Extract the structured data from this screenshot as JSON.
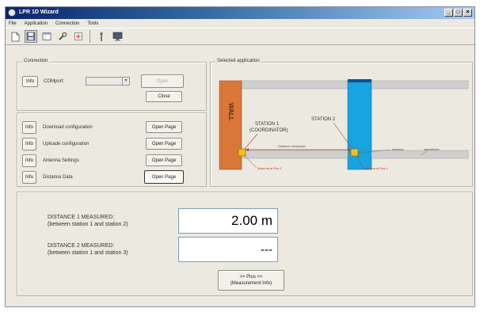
{
  "window": {
    "title": "LPR 1D Wizard"
  },
  "menu": [
    "File",
    "Application",
    "Connection",
    "Tools"
  ],
  "toolbar_icons": [
    "new-doc-icon",
    "disk-icon",
    "window-icon",
    "wrench-icon",
    "config-icon",
    "antenna-icon",
    "monitor-icon"
  ],
  "connection": {
    "title": "Connection",
    "info": "Info",
    "comport_label": "COMport:",
    "comport_value": "",
    "open_label": "Open",
    "close_label": "Close"
  },
  "pages": {
    "info": "Info",
    "rows": [
      {
        "label": "Download configuration",
        "button": "Open Page"
      },
      {
        "label": "Uploade configuration",
        "button": "Open Page"
      },
      {
        "label": "Antenna Settings",
        "button": "Open Page"
      },
      {
        "label": "Distance Data",
        "button": "Open Page"
      }
    ]
  },
  "application": {
    "title": "Selected application",
    "wall_label": "WALL",
    "station1_line1": "STATION 1",
    "station1_line2": "(COORDINATOR)",
    "station2_label": "STATION 2",
    "distance_label": "Distance measured",
    "antenna_label": "antenna",
    "stand_label": "stand/track",
    "ant1_label": "Antenna at Pos 1",
    "ant2_label": "Antenna at Pos 1",
    "colors": {
      "wall": "#d9773a",
      "station2": "#19a3e0",
      "station": "#f2c01a"
    }
  },
  "measure": {
    "d1_line1": "DISTANCE 1 MEASURED:",
    "d1_line2": "(between station 1 and station 2)",
    "d1_value": "2.00 m",
    "d2_line1": "DISTANCE 2 MEASURED:",
    "d2_line2": "(between station 1 and station 3)",
    "d2_value": "---",
    "more_line1": ">> Plus <<",
    "more_line2": "(Measurement Info)"
  }
}
